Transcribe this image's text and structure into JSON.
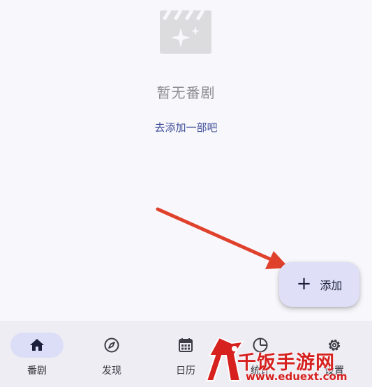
{
  "empty_state": {
    "icon": "movie-clapperboard-sparkle-icon",
    "title": "暂无番剧",
    "link": "去添加一部吧"
  },
  "annotation": {
    "icon": "red-arrow-icon",
    "color": "#e0412c"
  },
  "fab": {
    "icon": "plus-icon",
    "label": "添加"
  },
  "nav": {
    "active_index": 0,
    "items": [
      {
        "icon": "home-icon",
        "label": "番剧"
      },
      {
        "icon": "compass-icon",
        "label": "发现"
      },
      {
        "icon": "calendar-icon",
        "label": "日历"
      },
      {
        "icon": "pie-chart-icon",
        "label": "统计"
      },
      {
        "icon": "gear-icon",
        "label": "设置"
      }
    ]
  },
  "watermark": {
    "logo": "fan-logo",
    "text": "千饭手游网",
    "url": "www.eduext.com",
    "color": "#d6211f"
  }
}
